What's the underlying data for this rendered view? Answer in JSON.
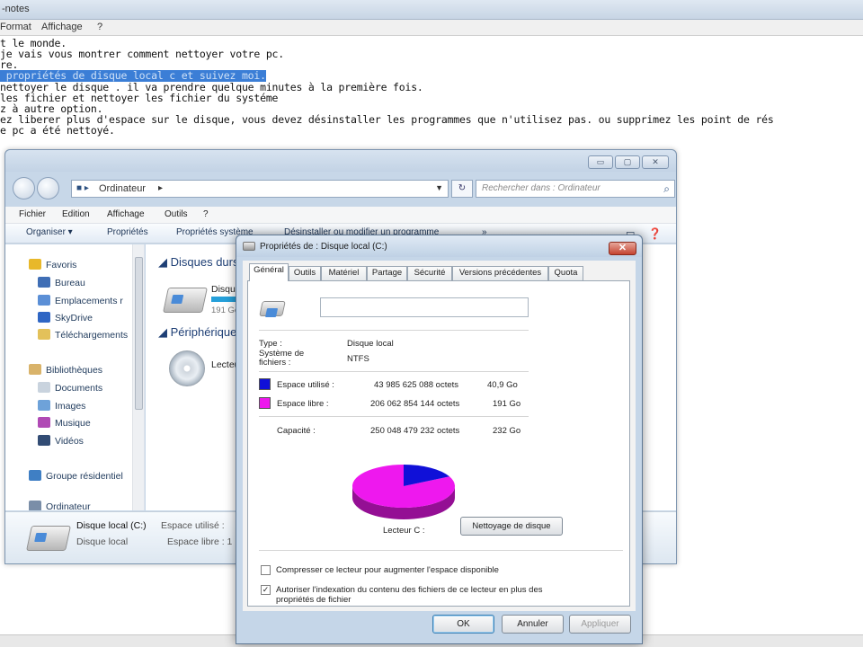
{
  "notepad": {
    "title": "-notes",
    "menu": [
      "Format",
      "Affichage",
      "?"
    ],
    "lines": [
      "t le monde.",
      "je vais vous montrer comment nettoyer votre pc.",
      "re.",
      " propriétés de disque local c et suivez moi.",
      "nettoyer le disque . il va prendre quelque minutes à la première fois.",
      "les fichier et nettoyer les fichier du systéme",
      "z à autre option.",
      "ez liberer plus d'espace sur le disque, vous devez désinstaller les programmes que n'utilisez pas. ou supprimez les point de rés",
      "e pc a été nettoyé."
    ]
  },
  "explorer": {
    "breadcrumb": "Ordinateur",
    "search_placeholder": "Rechercher dans : Ordinateur",
    "menu": [
      "Fichier",
      "Edition",
      "Affichage",
      "Outils",
      "?"
    ],
    "toolbar": [
      "Organiser ▾",
      "Propriétés",
      "Propriétés système",
      "Désinstaller ou modifier un programme",
      "»"
    ],
    "nav": [
      {
        "label": "Favoris",
        "color": "#e8b82a"
      },
      {
        "label": "Bureau",
        "color": "#3f6eb5"
      },
      {
        "label": "Emplacements r",
        "color": "#5b8fd6"
      },
      {
        "label": "SkyDrive",
        "color": "#2f66c4"
      },
      {
        "label": "Téléchargements",
        "color": "#e3c15a"
      },
      {
        "label": "Bibliothèques",
        "color": "#d9b36a"
      },
      {
        "label": "Documents",
        "color": "#c9d3de"
      },
      {
        "label": "Images",
        "color": "#6ea2d9"
      },
      {
        "label": "Musique",
        "color": "#b04ab5"
      },
      {
        "label": "Vidéos",
        "color": "#324c74"
      },
      {
        "label": "Groupe résidentiel",
        "color": "#3f7fc4"
      },
      {
        "label": "Ordinateur",
        "color": "#7a8ea8"
      }
    ],
    "groups": {
      "disks": "Disques durs",
      "devices": "Périphériques",
      "disk_name": "Disque",
      "disk_size": "191 Go",
      "device_name": "Lecteur"
    },
    "details": {
      "name": "Disque local (C:)",
      "type": "Disque local",
      "used_label": "Espace utilisé :",
      "free_label": "Espace libre : 1"
    }
  },
  "dialog": {
    "title": "Propriétés de : Disque local (C:)",
    "tabs": [
      "Général",
      "Outils",
      "Matériel",
      "Partage",
      "Sécurité",
      "Versions précédentes",
      "Quota"
    ],
    "type_label": "Type :",
    "type_value": "Disque local",
    "fs_label": "Système de fichiers :",
    "fs_value": "NTFS",
    "used": {
      "label": "Espace utilisé :",
      "bytes": "43 985 625 088 octets",
      "size": "40,9 Go",
      "color": "#1010d8",
      "value_go": 40.9
    },
    "free": {
      "label": "Espace libre :",
      "bytes": "206 062 854 144 octets",
      "size": "191 Go",
      "color": "#ee18ee",
      "value_go": 191
    },
    "capacity": {
      "label": "Capacité :",
      "bytes": "250 048 479 232 octets",
      "size": "232 Go"
    },
    "drive_label": "Lecteur C :",
    "clean_button": "Nettoyage de disque",
    "compress_label": "Compresser ce lecteur pour augmenter l'espace disponible",
    "compress_checked": false,
    "index_label": "Autoriser l'indexation du contenu des fichiers de ce lecteur en plus des propriétés de fichier",
    "index_checked": true,
    "buttons": {
      "ok": "OK",
      "cancel": "Annuler",
      "apply": "Appliquer"
    }
  }
}
